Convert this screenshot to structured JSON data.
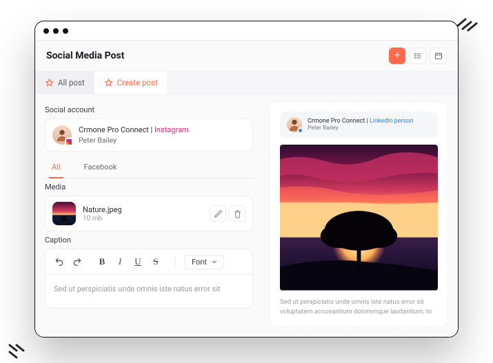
{
  "header": {
    "title": "Social Media Post"
  },
  "tabs": {
    "all_post": "All post",
    "create_post": "Create post"
  },
  "sections": {
    "social_account": "Social account",
    "media": "Media",
    "caption": "Caption"
  },
  "account": {
    "connect_label": "Crmone Pro Connect |",
    "platform": "Instagram",
    "user_name": "Peter Bailey"
  },
  "subtabs": {
    "all": "All",
    "facebook": "Facebook"
  },
  "media": {
    "file_name": "Nature.jpeg",
    "file_size": "10 mb"
  },
  "editor": {
    "font_label": "Font",
    "body": "Sed ut perspiciatis unde omnis iste natus error sit"
  },
  "preview": {
    "connect_label": "Crmone Pro Connect |",
    "platform": "Linkedin person",
    "user_name": "Peter Bailey",
    "caption": "Sed ut perspiciatis unde omnis iste natus error sit voluptatem accusantium doloremque laudantium, to"
  }
}
